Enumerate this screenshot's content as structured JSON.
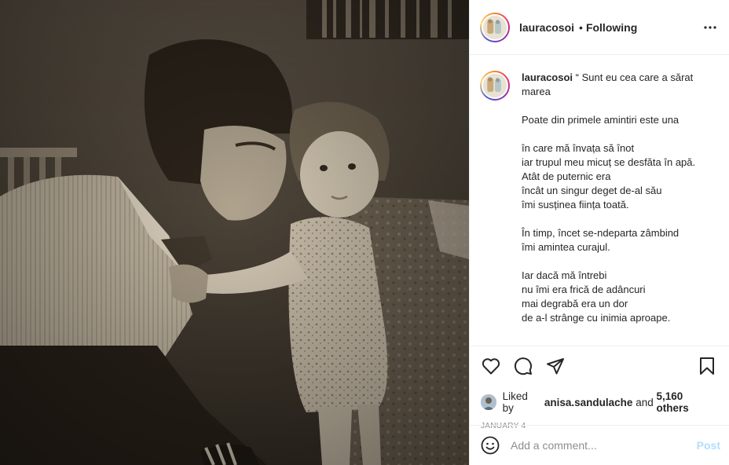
{
  "photo": {
    "alt_subject": "sepia-photo"
  },
  "post": {
    "username": "lauracosoi",
    "dot": "•",
    "follow_status": "Following",
    "caption_lines": [
      "“ Sunt eu cea care a sărat",
      "marea",
      "",
      "Poate din primele amintiri este una",
      "",
      "în care mă învața să înot",
      "iar trupul meu micuț se desfăta în apă.",
      "Atât de puternic era",
      "încât un singur deget de-al său",
      "îmi susținea ființa toată.",
      "",
      "În timp, încet se-ndeparta zâmbind",
      "îmi amintea curajul.",
      "",
      "Iar dacă mă întrebi",
      "nu îmi era frică de adâncuri",
      "mai degrabă era un dor",
      "de a-l strânge cu inimia aproape."
    ],
    "likes": {
      "prefix": "Liked by",
      "user": "anisa.sandulache",
      "and": "and",
      "others": "5,160 others"
    },
    "date": "JANUARY 4"
  },
  "comment": {
    "placeholder": "Add a comment...",
    "post_label": "Post"
  },
  "icons": [
    "more-options-icon",
    "heart-icon",
    "comment-icon",
    "share-icon",
    "bookmark-icon",
    "emoji-icon"
  ],
  "colors": {
    "text": "#262626",
    "muted": "#8e8e8e",
    "post_disabled": "#b2dffc",
    "border": "#efefef"
  }
}
